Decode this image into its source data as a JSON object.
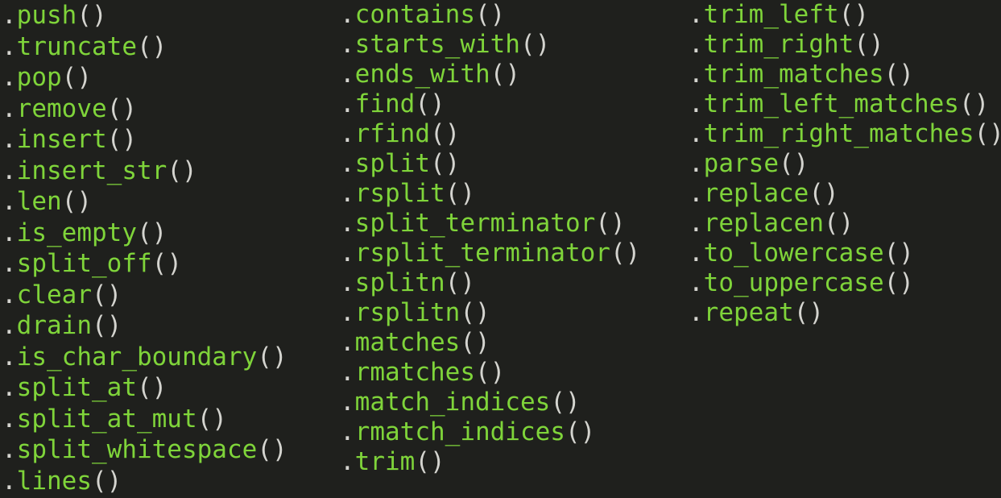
{
  "colors": {
    "background": "#1f201d",
    "method_name": "#7fd43a",
    "punctuation": "#d4d4cf"
  },
  "columns": [
    {
      "methods": [
        "push",
        "truncate",
        "pop",
        "remove",
        "insert",
        "insert_str",
        "len",
        "is_empty",
        "split_off",
        "clear",
        "drain",
        "is_char_boundary",
        "split_at",
        "split_at_mut",
        "split_whitespace",
        "lines"
      ]
    },
    {
      "methods": [
        "contains",
        "starts_with",
        "ends_with",
        "find",
        "rfind",
        "split",
        "rsplit",
        "split_terminator",
        "rsplit_terminator",
        "splitn",
        "rsplitn",
        "matches",
        "rmatches",
        "match_indices",
        "rmatch_indices",
        "trim"
      ]
    },
    {
      "methods": [
        "trim_left",
        "trim_right",
        "trim_matches",
        "trim_left_matches",
        "trim_right_matches",
        "parse",
        "replace",
        "replacen",
        "to_lowercase",
        "to_uppercase",
        "repeat"
      ]
    }
  ]
}
